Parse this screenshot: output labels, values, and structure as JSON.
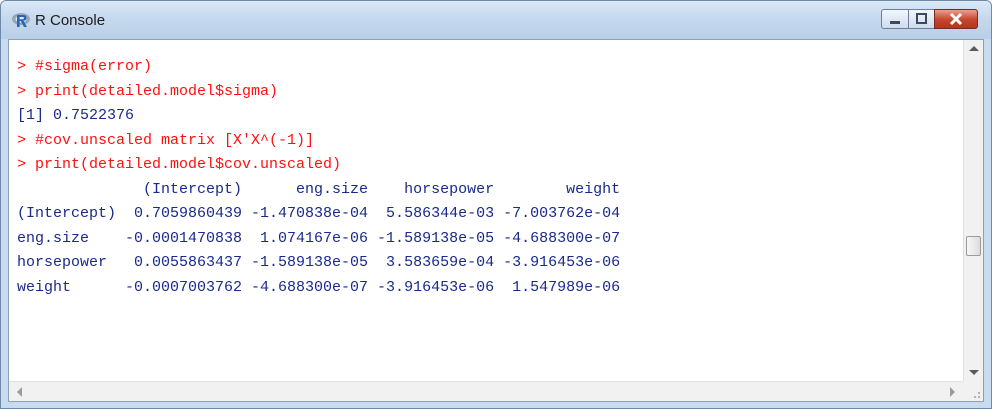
{
  "window": {
    "title": "R Console",
    "icon": "r-logo-icon",
    "controls": [
      "minimize-icon",
      "maximize-icon",
      "close-icon"
    ]
  },
  "console": {
    "lines": [
      {
        "kind": "input",
        "text": "> #sigma(error)"
      },
      {
        "kind": "input",
        "text": "> print(detailed.model$sigma)"
      },
      {
        "kind": "output",
        "text": "[1] 0.7522376"
      },
      {
        "kind": "input",
        "text": "> #cov.unscaled matrix [X'X^(-1)]"
      },
      {
        "kind": "input",
        "text": "> print(detailed.model$cov.unscaled)"
      },
      {
        "kind": "output",
        "text": "              (Intercept)      eng.size    horsepower        weight"
      },
      {
        "kind": "output",
        "text": "(Intercept)  0.7059860439 -1.470838e-04  5.586344e-03 -7.003762e-04"
      },
      {
        "kind": "output",
        "text": "eng.size    -0.0001470838  1.074167e-06 -1.589138e-05 -4.688300e-07"
      },
      {
        "kind": "output",
        "text": "horsepower   0.0055863437 -1.589138e-05  3.583659e-04 -3.916453e-06"
      },
      {
        "kind": "output",
        "text": "weight      -0.0007003762 -4.688300e-07 -3.916453e-06  1.547989e-06"
      }
    ]
  },
  "colors": {
    "input": "#ff1010",
    "output": "#1a2a8c"
  }
}
